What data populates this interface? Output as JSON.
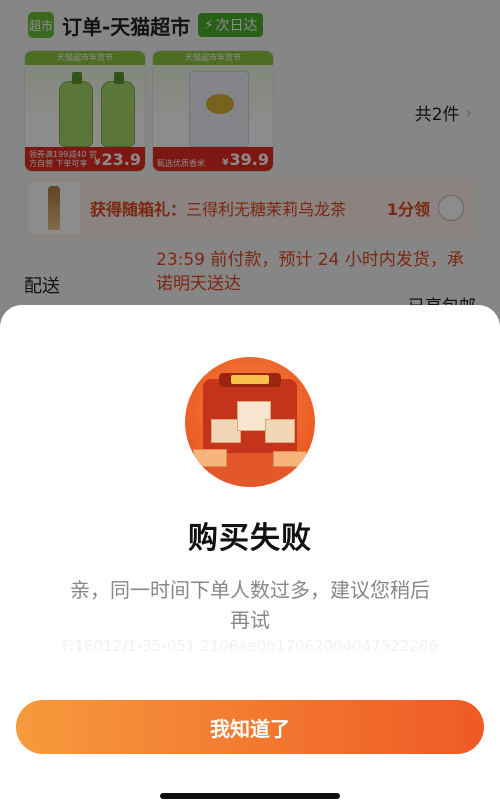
{
  "order": {
    "store_logo_text": "超市",
    "store_name": "订单-天猫超市",
    "delivery_badge": "次日达",
    "products": [
      {
        "top_banner": "天猫超市年货节",
        "promo_text": "领券满199减40 官方自营 下单可享",
        "price": "23.9",
        "currency": "¥"
      },
      {
        "top_banner": "天猫超市年货节",
        "promo_text": "甄选优质香米",
        "price": "39.9",
        "currency": "¥"
      }
    ],
    "item_count": "共2件",
    "gift": {
      "prefix": "获得随箱礼：",
      "name": "三得利无糖茉莉乌龙茶",
      "claim": "1分领"
    },
    "shipping_label": "配送",
    "shipping_note": "23:59 前付款，预计 24 小时内发货，承诺明天送达",
    "free_shipping": "已享包邮"
  },
  "modal": {
    "title": "购买失败",
    "message": "亲，同一时间下单人数过多，建议您稍后再试",
    "trace_id": "F:16012/1-35-051 2106ae0b17062004047522286",
    "ok_button": "我知道了"
  }
}
